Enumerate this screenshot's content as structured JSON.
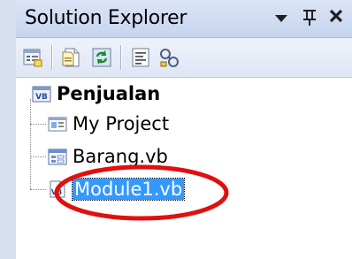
{
  "window": {
    "title": "Solution Explorer",
    "dropdown_icon": "dropdown-arrow",
    "pin_glyph": "Ĺ",
    "close_glyph": "✕"
  },
  "toolbar": {
    "buttons": [
      {
        "icon": "properties-icon"
      },
      {
        "icon": "show-all-files-icon"
      },
      {
        "icon": "refresh-icon"
      },
      {
        "icon": "view-code-icon"
      },
      {
        "icon": "class-view-icon"
      }
    ]
  },
  "tree": {
    "root": {
      "label": "Penjualan",
      "icon": "vb-project-icon"
    },
    "items": [
      {
        "label": "My Project",
        "icon": "my-project-icon"
      },
      {
        "label": "Barang.vb",
        "icon": "form-icon"
      },
      {
        "label": "Module1.vb",
        "icon": "module-icon",
        "selected": true
      }
    ]
  },
  "annotation": {
    "shape": "ellipse",
    "color": "#e01010",
    "target": "Module1.vb"
  }
}
